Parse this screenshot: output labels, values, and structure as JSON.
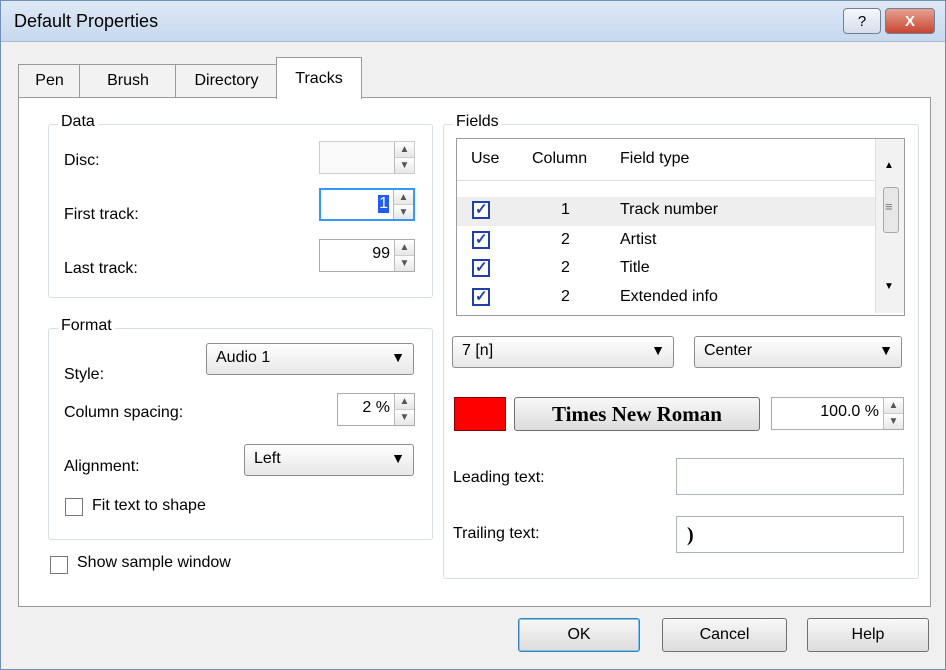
{
  "window": {
    "title": "Default Properties",
    "help_symbol": "?",
    "close_symbol": "X"
  },
  "tabs": [
    {
      "label": "Pen"
    },
    {
      "label": "Brush"
    },
    {
      "label": "Directory"
    },
    {
      "label": "Tracks",
      "active": true
    }
  ],
  "data_group": {
    "legend": "Data",
    "disc_label": "Disc:",
    "disc_value": "",
    "first_track_label": "First track:",
    "first_track_value": "1",
    "last_track_label": "Last track:",
    "last_track_value": "99"
  },
  "format_group": {
    "legend": "Format",
    "style_label": "Style:",
    "style_value": "Audio 1",
    "column_spacing_label": "Column spacing:",
    "column_spacing_value": "2 %",
    "alignment_label": "Alignment:",
    "alignment_value": "Left",
    "fit_text_label": "Fit text to shape",
    "fit_text_checked": false
  },
  "show_sample_window": {
    "label": "Show sample window",
    "checked": false
  },
  "fields_group": {
    "legend": "Fields",
    "columns": [
      "Use",
      "Column",
      "Field type"
    ],
    "rows": [
      {
        "use": true,
        "column": "1",
        "field_type": "Track number",
        "selected": true
      },
      {
        "use": true,
        "column": "2",
        "field_type": "Artist"
      },
      {
        "use": true,
        "column": "2",
        "field_type": "Title"
      },
      {
        "use": true,
        "column": "2",
        "field_type": "Extended info"
      }
    ],
    "size_value": "7 [n]",
    "alignment_value": "Center",
    "font_color": "#ff0000",
    "font_name": "Times New Roman",
    "scale_value": "100.0 %",
    "leading_text_label": "Leading text:",
    "leading_text_value": "",
    "trailing_text_label": "Trailing text:",
    "trailing_text_value": ")"
  },
  "buttons": {
    "ok": "OK",
    "cancel": "Cancel",
    "help": "Help"
  },
  "icons": {
    "dropdown": "▼",
    "spin_up": "▲",
    "spin_down": "▼",
    "check": "✓",
    "scroll_up": "▲",
    "scroll_down": "▼",
    "scroll_grip": "≡"
  }
}
